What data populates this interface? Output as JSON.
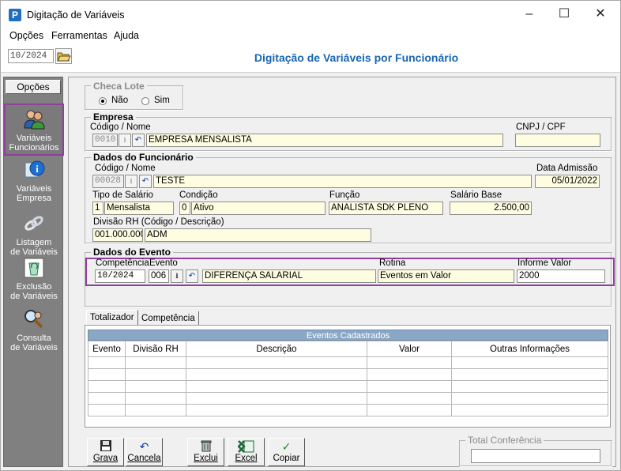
{
  "window": {
    "app_icon": "P",
    "title": "Digitação de Variáveis",
    "minimize": "–",
    "maximize": "☐",
    "close": "✕"
  },
  "menu": [
    "Opções",
    "Ferramentas",
    "Ajuda"
  ],
  "header": {
    "period": "10/2024",
    "title": "Digitação de Variáveis por Funcionário"
  },
  "sidebar": {
    "header": "Opções",
    "items": [
      {
        "label1": "Variáveis",
        "label2": "Funcionários",
        "icon": "people-icon"
      },
      {
        "label1": "Variáveis",
        "label2": "Empresa",
        "icon": "info-icon"
      },
      {
        "label1": "Listagem",
        "label2": "de Variáveis",
        "icon": "chain-icon"
      },
      {
        "label1": "Exclusão",
        "label2": "de Variáveis",
        "icon": "recycle-icon"
      },
      {
        "label1": "Consulta",
        "label2": "de Variáveis",
        "icon": "magnifier-icon"
      }
    ]
  },
  "checa_lote": {
    "legend": "Checa Lote",
    "opt_nao": "Não",
    "opt_sim": "Sim",
    "selected": "Não"
  },
  "empresa": {
    "legend": "Empresa",
    "codigo_label": "Código / Nome",
    "codigo": "0010",
    "nome": "EMPRESA MENSALISTA",
    "cnpj_label": "CNPJ / CPF",
    "cnpj": ""
  },
  "funcionario": {
    "legend": "Dados do Funcionário",
    "codigo_label": "Código / Nome",
    "codigo": "00028",
    "nome": "TESTE",
    "admissao_label": "Data Admissão",
    "admissao": "05/01/2022",
    "tipo_label": "Tipo de Salário",
    "tipo_cod": "1",
    "tipo": "Mensalista",
    "condicao_label": "Condição",
    "condicao_cod": "0",
    "condicao": "Ativo",
    "funcao_label": "Função",
    "funcao": "ANALISTA SDK PLENO",
    "salario_label": "Salário Base",
    "salario": "2.500,00",
    "divisao_label": "Divisão RH (Código / Descrição)",
    "divisao_cod": "001.000.000",
    "divisao": "ADM"
  },
  "evento": {
    "legend": "Dados do Evento",
    "competencia_label": "Competência",
    "competencia": "10/2024",
    "evento_label": "Evento",
    "evento_cod": "006",
    "evento": "DIFERENÇA SALARIAL",
    "rotina_label": "Rotina",
    "rotina": "Eventos em Valor",
    "informe_label": "Informe Valor",
    "informe": "2000"
  },
  "tabs": [
    "Totalizador",
    "Competência"
  ],
  "grid": {
    "caption": "Eventos Cadastrados",
    "columns": [
      "Evento",
      "Divisão RH",
      "Descrição",
      "Valor",
      "Outras Informações"
    ]
  },
  "buttons": [
    {
      "label": "Grava",
      "icon": "floppy-icon"
    },
    {
      "label": "Cancela",
      "icon": "undo-icon"
    },
    {
      "label": "Exclui",
      "icon": "trash-icon"
    },
    {
      "label": "Excel",
      "icon": "excel-icon"
    },
    {
      "label": "Copiar",
      "icon": "check-icon"
    }
  ],
  "total_conferencia": {
    "legend": "Total Conferência",
    "value": ""
  },
  "colors": {
    "accent": "#1a66b3",
    "highlight": "#8f3f9c",
    "input_bg": "#fffde1",
    "sidebar_bg": "#808080"
  }
}
